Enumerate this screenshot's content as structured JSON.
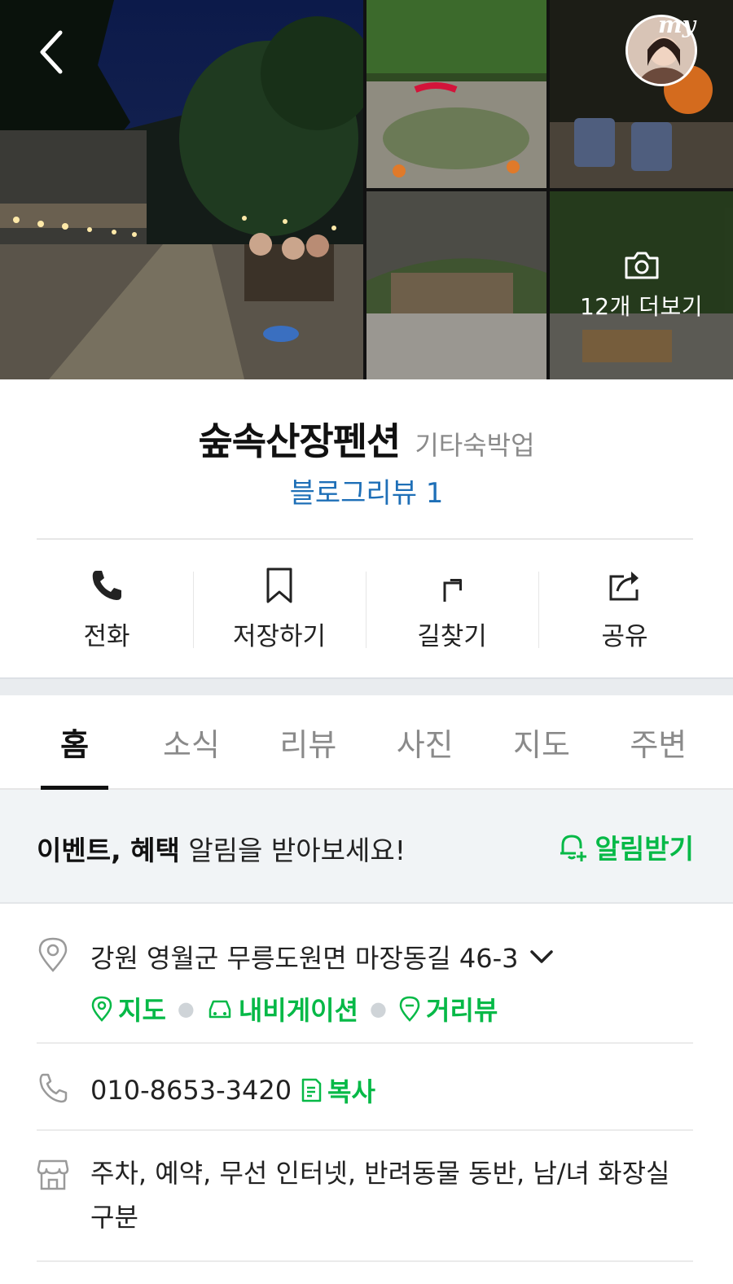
{
  "gallery": {
    "more_label": "12개 더보기",
    "my_badge": "my"
  },
  "place": {
    "name": "숲속산장펜션",
    "category": "기타숙박업",
    "blog_review": "블로그리뷰 1"
  },
  "actions": [
    {
      "label": "전화",
      "icon": "phone-icon"
    },
    {
      "label": "저장하기",
      "icon": "bookmark-icon"
    },
    {
      "label": "길찾기",
      "icon": "directions-icon"
    },
    {
      "label": "공유",
      "icon": "share-icon"
    }
  ],
  "tabs": [
    {
      "label": "홈",
      "active": true
    },
    {
      "label": "소식"
    },
    {
      "label": "리뷰"
    },
    {
      "label": "사진"
    },
    {
      "label": "지도"
    },
    {
      "label": "주변"
    }
  ],
  "banner": {
    "bold1": "이벤트, 혜택",
    "rest": " 알림을 받아보세요!",
    "button": "알림받기"
  },
  "address": {
    "text": "강원 영월군 무릉도원면 마장동길 46-3",
    "links": {
      "map": "지도",
      "navigation": "내비게이션",
      "streetview": "거리뷰"
    }
  },
  "phone": {
    "number": "010-8653-3420",
    "copy": "복사"
  },
  "amenities": {
    "text": "주차, 예약, 무선 인터넷, 반려동물 동반, 남/녀 화장실 구분"
  },
  "colors": {
    "accent_green": "#06b947",
    "link_blue": "#1e6fb7"
  }
}
